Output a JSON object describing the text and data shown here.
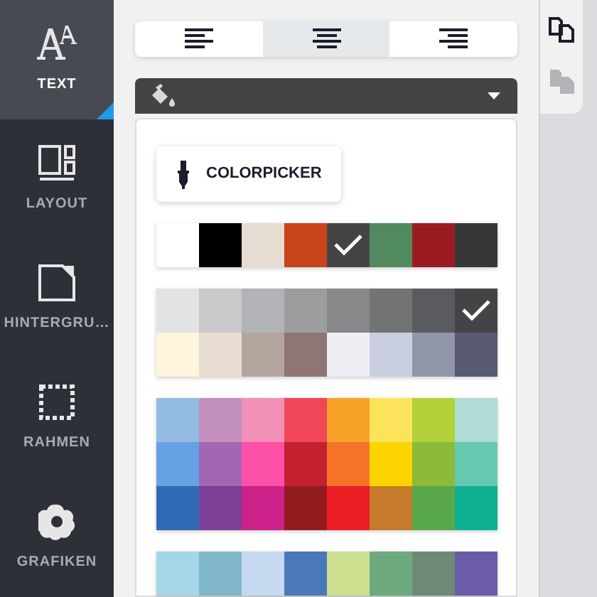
{
  "sidebar": {
    "items": [
      {
        "label": "TEXT",
        "kind": "text",
        "selected": true
      },
      {
        "label": "LAYOUT",
        "kind": "layout",
        "selected": false
      },
      {
        "label": "HINTERGRU…",
        "kind": "background",
        "selected": false
      },
      {
        "label": "RAHMEN",
        "kind": "frame",
        "selected": false
      },
      {
        "label": "GRAFIKEN",
        "kind": "graphics",
        "selected": false
      }
    ]
  },
  "alignment": [
    {
      "kind": "left",
      "selected": false
    },
    {
      "kind": "center",
      "selected": true
    },
    {
      "kind": "right",
      "selected": false
    }
  ],
  "fill_dropdown": {
    "expanded": true
  },
  "colorpicker": {
    "label": "COLORPICKER"
  },
  "palettes": [
    {
      "rows": [
        [
          {
            "color": "#ffffff",
            "selected": false
          },
          {
            "color": "#000000",
            "selected": false
          },
          {
            "color": "#e6ddd2",
            "selected": false
          },
          {
            "color": "#c8441a",
            "selected": false
          },
          {
            "color": "#444446",
            "selected": true
          },
          {
            "color": "#528a5f",
            "selected": false
          },
          {
            "color": "#9b1c20",
            "selected": false
          },
          {
            "color": "#373737",
            "selected": false
          }
        ]
      ]
    },
    {
      "rows": [
        [
          {
            "color": "#e2e3e5",
            "selected": false
          },
          {
            "color": "#c8c9cb",
            "selected": false
          },
          {
            "color": "#b2b3b6",
            "selected": false
          },
          {
            "color": "#9c9d9f",
            "selected": false
          },
          {
            "color": "#878889",
            "selected": false
          },
          {
            "color": "#727375",
            "selected": false
          },
          {
            "color": "#5a5b5e",
            "selected": false
          },
          {
            "color": "#444446",
            "selected": true
          }
        ],
        [
          {
            "color": "#fff5dc",
            "selected": false
          },
          {
            "color": "#e7ddd1",
            "selected": false
          },
          {
            "color": "#b3a59e",
            "selected": false
          },
          {
            "color": "#8f7576",
            "selected": false
          },
          {
            "color": "#eeeef4",
            "selected": false
          },
          {
            "color": "#c8cede",
            "selected": false
          },
          {
            "color": "#9196a8",
            "selected": false
          },
          {
            "color": "#575a70",
            "selected": false
          }
        ]
      ]
    },
    {
      "rows": [
        [
          {
            "color": "#94bbe3",
            "selected": false
          },
          {
            "color": "#c490c0",
            "selected": false
          },
          {
            "color": "#f290b8",
            "selected": false
          },
          {
            "color": "#f04657",
            "selected": false
          },
          {
            "color": "#f9a22a",
            "selected": false
          },
          {
            "color": "#fde35c",
            "selected": false
          },
          {
            "color": "#b3cf3a",
            "selected": false
          },
          {
            "color": "#afddd5",
            "selected": false
          }
        ],
        [
          {
            "color": "#66a1e4",
            "selected": false
          },
          {
            "color": "#a167b3",
            "selected": false
          },
          {
            "color": "#fc51a7",
            "selected": false
          },
          {
            "color": "#c4212f",
            "selected": false
          },
          {
            "color": "#f6742a",
            "selected": false
          },
          {
            "color": "#fbd400",
            "selected": false
          },
          {
            "color": "#8dba3b",
            "selected": false
          },
          {
            "color": "#66c9b2",
            "selected": false
          }
        ],
        [
          {
            "color": "#2f69b4",
            "selected": false
          },
          {
            "color": "#7c3f98",
            "selected": false
          },
          {
            "color": "#cb2189",
            "selected": false
          },
          {
            "color": "#931b1f",
            "selected": false
          },
          {
            "color": "#ed1d26",
            "selected": false
          },
          {
            "color": "#c67c2a",
            "selected": false
          },
          {
            "color": "#58a84a",
            "selected": false
          },
          {
            "color": "#0faf92",
            "selected": false
          }
        ]
      ]
    },
    {
      "rows": [
        [
          {
            "color": "#a5d6e8",
            "selected": false
          },
          {
            "color": "#7fb7c9",
            "selected": false
          },
          {
            "color": "#c6d9f0",
            "selected": false
          },
          {
            "color": "#4a78b8",
            "selected": false
          },
          {
            "color": "#cde08f",
            "selected": false
          },
          {
            "color": "#6eaa80",
            "selected": false
          },
          {
            "color": "#6d8a78",
            "selected": false
          },
          {
            "color": "#6c5ca8",
            "selected": false
          }
        ]
      ]
    }
  ],
  "actions": [
    {
      "kind": "copy",
      "disabled": false
    },
    {
      "kind": "paste",
      "disabled": true
    }
  ]
}
